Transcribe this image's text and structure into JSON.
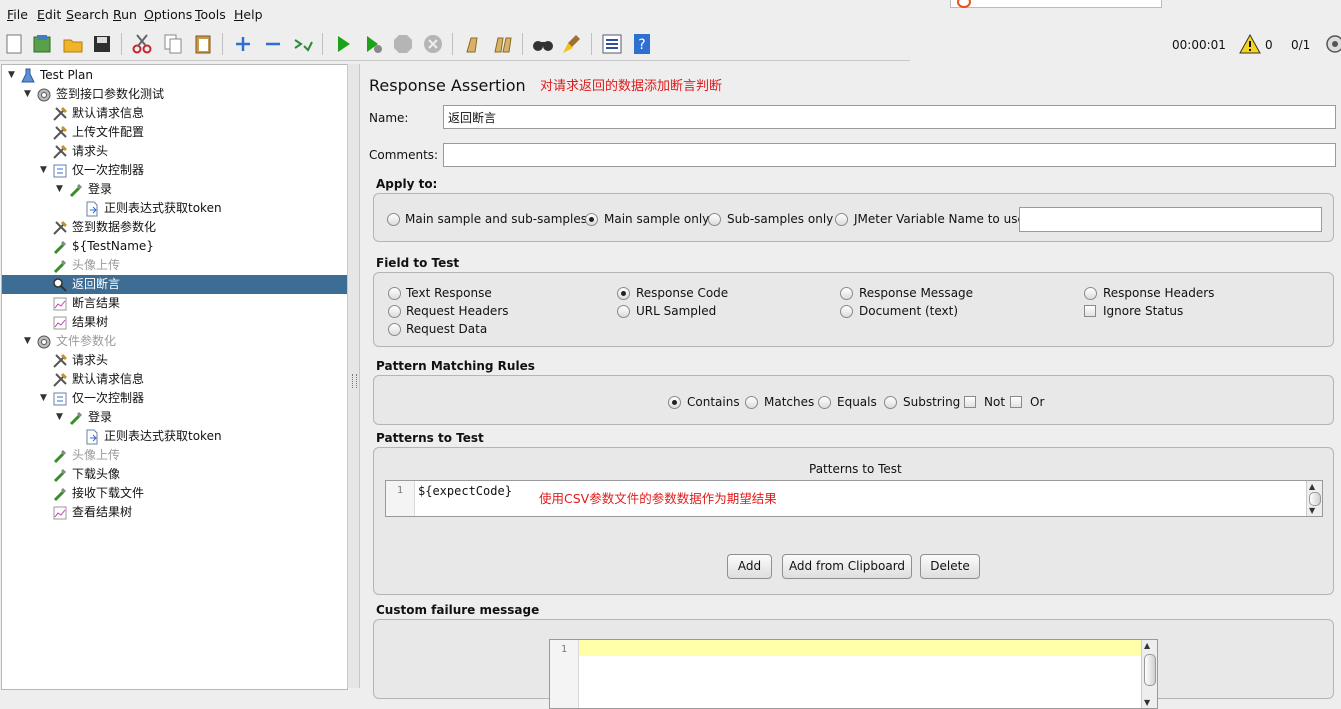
{
  "menu": [
    {
      "label": "File",
      "mnemonic": "F"
    },
    {
      "label": "Edit",
      "mnemonic": "E"
    },
    {
      "label": "Search",
      "mnemonic": "S"
    },
    {
      "label": "Run",
      "mnemonic": "R"
    },
    {
      "label": "Options",
      "mnemonic": "O"
    },
    {
      "label": "Tools",
      "mnemonic": "T"
    },
    {
      "label": "Help",
      "mnemonic": "H"
    }
  ],
  "toolbar": {
    "icons": [
      "new-icon",
      "templates-icon",
      "open-icon",
      "save-icon",
      "cut-icon",
      "copy-icon",
      "paste-icon",
      "expand-icon",
      "collapse-icon",
      "toggle-icon",
      "start-icon",
      "start-no-pause-icon",
      "stop-icon",
      "shutdown-icon",
      "clear-icon",
      "clear-all-icon",
      "search-icon",
      "reset-search-icon",
      "function-helper-icon",
      "help-icon"
    ],
    "elapsed_time": "00:00:01",
    "warning_count": "0",
    "threads": "0/1"
  },
  "tree": {
    "items": [
      {
        "label": "Test Plan",
        "icon": "test-plan-icon",
        "level": 0,
        "expanded": true,
        "disabled": false,
        "selected": false
      },
      {
        "label": "签到接口参数化测试",
        "icon": "thread-group-icon",
        "level": 1,
        "expanded": true,
        "disabled": false,
        "selected": false
      },
      {
        "label": "默认请求信息",
        "icon": "config-element-icon",
        "level": 2,
        "disabled": false,
        "selected": false
      },
      {
        "label": "上传文件配置",
        "icon": "config-element-icon",
        "level": 2,
        "disabled": false,
        "selected": false
      },
      {
        "label": "请求头",
        "icon": "config-element-icon",
        "level": 2,
        "disabled": false,
        "selected": false
      },
      {
        "label": "仅一次控制器",
        "icon": "controller-icon",
        "level": 2,
        "expanded": true,
        "disabled": false,
        "selected": false
      },
      {
        "label": "登录",
        "icon": "sampler-icon",
        "level": 3,
        "expanded": true,
        "disabled": false,
        "selected": false
      },
      {
        "label": "正则表达式获取token",
        "icon": "post-processor-icon",
        "level": 4,
        "disabled": false,
        "selected": false
      },
      {
        "label": "签到数据参数化",
        "icon": "config-element-icon",
        "level": 2,
        "disabled": false,
        "selected": false
      },
      {
        "label": "${TestName}",
        "icon": "sampler-icon",
        "level": 2,
        "disabled": false,
        "selected": false
      },
      {
        "label": "头像上传",
        "icon": "sampler-icon",
        "level": 2,
        "disabled": true,
        "selected": false
      },
      {
        "label": "返回断言",
        "icon": "assertion-icon",
        "level": 2,
        "disabled": false,
        "selected": true
      },
      {
        "label": "断言结果",
        "icon": "listener-icon",
        "level": 2,
        "disabled": false,
        "selected": false
      },
      {
        "label": "结果树",
        "icon": "listener-icon",
        "level": 2,
        "disabled": false,
        "selected": false
      },
      {
        "label": "文件参数化",
        "icon": "thread-group-icon",
        "level": 1,
        "expanded": true,
        "disabled": true,
        "selected": false
      },
      {
        "label": "请求头",
        "icon": "config-element-icon",
        "level": 2,
        "disabled": false,
        "selected": false
      },
      {
        "label": "默认请求信息",
        "icon": "config-element-icon",
        "level": 2,
        "disabled": false,
        "selected": false
      },
      {
        "label": "仅一次控制器",
        "icon": "controller-icon",
        "level": 2,
        "expanded": true,
        "disabled": false,
        "selected": false
      },
      {
        "label": "登录",
        "icon": "sampler-icon",
        "level": 3,
        "expanded": true,
        "disabled": false,
        "selected": false
      },
      {
        "label": "正则表达式获取token",
        "icon": "post-processor-icon",
        "level": 4,
        "disabled": false,
        "selected": false
      },
      {
        "label": "头像上传",
        "icon": "sampler-icon",
        "level": 2,
        "disabled": true,
        "selected": false
      },
      {
        "label": "下载头像",
        "icon": "sampler-icon",
        "level": 2,
        "disabled": false,
        "selected": false
      },
      {
        "label": "接收下载文件",
        "icon": "sampler-icon",
        "level": 2,
        "disabled": false,
        "selected": false
      },
      {
        "label": "查看结果树",
        "icon": "listener-icon",
        "level": 2,
        "disabled": false,
        "selected": false
      }
    ]
  },
  "panel": {
    "title": "Response Assertion",
    "title_note": "对请求返回的数据添加断言判断",
    "name_label": "Name:",
    "name_value": "返回断言",
    "comments_label": "Comments:",
    "comments_value": "",
    "apply_to": {
      "title": "Apply to:",
      "options": [
        "Main sample and sub-samples",
        "Main sample only",
        "Sub-samples only",
        "JMeter Variable Name to use"
      ],
      "selected": "Main sample only",
      "variable_value": ""
    },
    "field_to_test": {
      "title": "Field to Test",
      "options": [
        "Text Response",
        "Request Headers",
        "Request Data",
        "Response Code",
        "URL Sampled",
        "Response Message",
        "Document (text)",
        "Response Headers"
      ],
      "selected": "Response Code",
      "ignore_status_label": "Ignore Status",
      "ignore_status": false
    },
    "pattern_rules": {
      "title": "Pattern Matching Rules",
      "options": [
        "Contains",
        "Matches",
        "Equals",
        "Substring"
      ],
      "selected": "Contains",
      "not_label": "Not",
      "not": false,
      "or_label": "Or",
      "or": false
    },
    "patterns": {
      "title": "Patterns to Test",
      "table_header": "Patterns to Test",
      "line_number": "1",
      "value": "${expectCode}",
      "note": "使用CSV参数文件的参数数据作为期望结果",
      "add_label": "Add",
      "add_clipboard_label": "Add from Clipboard",
      "delete_label": "Delete"
    },
    "failure": {
      "title": "Custom failure message",
      "line_number": "1",
      "value": ""
    }
  },
  "colors": {
    "selection": "#3d6c94",
    "note": "#e01b1b",
    "highlight_line": "#ffffaa",
    "start_green": "#1aa31a"
  }
}
